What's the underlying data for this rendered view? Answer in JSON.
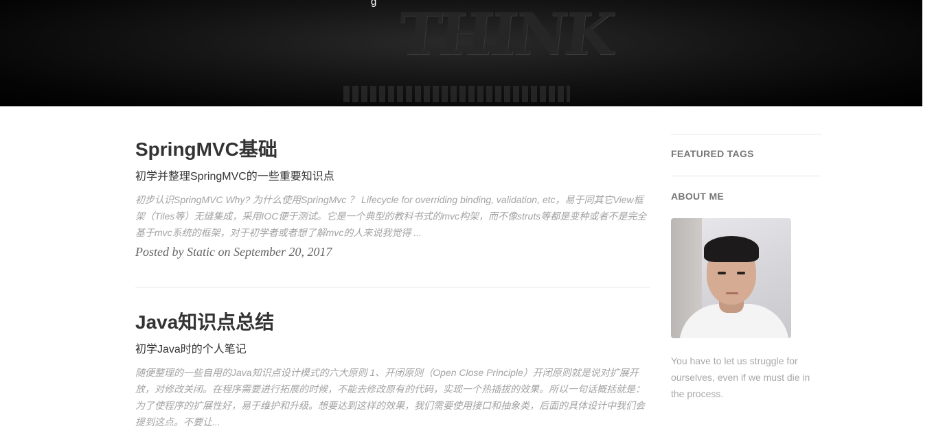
{
  "header": {
    "nav_glyph": "g",
    "banner_word": "THINK"
  },
  "posts": [
    {
      "title": "SpringMVC基础",
      "subtitle": "初学并整理SpringMVC的一些重要知识点",
      "excerpt": "初步认识SpringMVC Why? 为什么使用SpringMvc ？ Lifecycle for overriding binding, validation, etc，易于同其它View框架（Tiles等）无缝集成，采用IOC便于测试。它是一个典型的教科书式的mvc构架，而不像struts等都是变种或者不是完全基于mvc系统的框架，对于初学者或者想了解mvc的人来说我觉得 ...",
      "meta": "Posted by Static on September 20, 2017"
    },
    {
      "title": "Java知识点总结",
      "subtitle": "初学Java时的个人笔记",
      "excerpt": "随便整理的一些自用的Java知识点设计模式的六大原则 1、开闭原则（Open Close Principle）开闭原则就是说对扩展开放，对修改关闭。在程序需要进行拓展的时候，不能去修改原有的代码，实现一个热插拔的效果。所以一句话概括就是：为了使程序的扩展性好，易于维护和升级。想要达到这样的效果，我们需要使用接口和抽象类，后面的具体设计中我们会提到这点。不要让...",
      "meta": ""
    }
  ],
  "sidebar": {
    "featured_tags_heading": "FEATURED TAGS",
    "about_heading": "ABOUT ME",
    "about_text": "You have to let us struggle for ourselves, even if we must die in the process."
  }
}
